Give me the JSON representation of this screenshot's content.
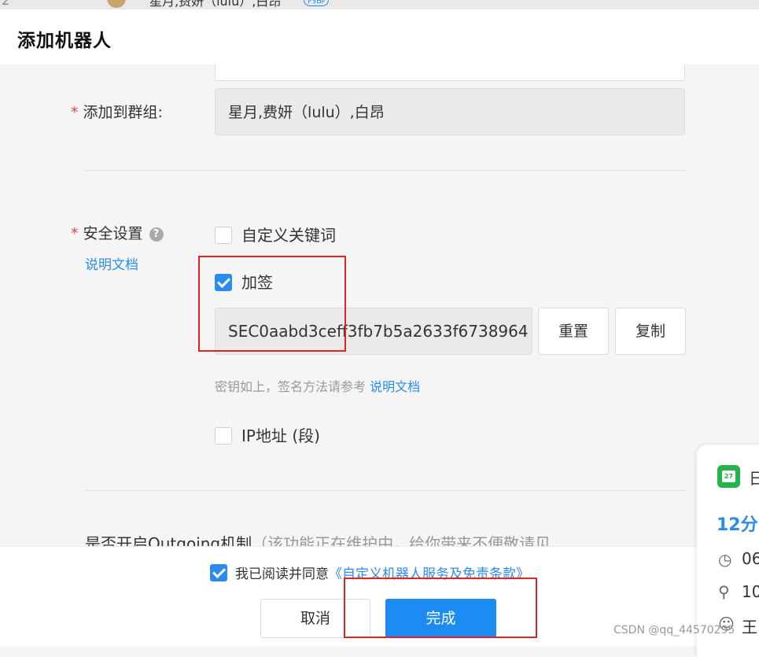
{
  "top_strip": {
    "count_text": "2",
    "chat_title": "星月,费妍（lulu）,白昂",
    "badge": "内部"
  },
  "dialog": {
    "title": "添加机器人"
  },
  "form": {
    "add_to_group_label": "添加到群组:",
    "group_value": "星月,费妍（lulu）,白昂",
    "security_label": "安全设置",
    "help_icon_glyph": "?",
    "doc_link": "说明文档",
    "options": {
      "custom_keywords": {
        "label": "自定义关键词",
        "checked": false
      },
      "signature": {
        "label": "加签",
        "checked": true
      },
      "ip_address": {
        "label": "IP地址 (段)",
        "checked": false
      }
    },
    "secret_value": "SEC0aabd3ceff3fb7b5a2633f6738964",
    "reset_button": "重置",
    "copy_button": "复制",
    "hint_text": "密钥如上，签名方法请参考",
    "hint_link": "说明文档",
    "outgoing_label": "是否开启Outgoing机制",
    "outgoing_note": "（该功能正在维护中，给你带来不便敬请见"
  },
  "footer": {
    "agree_checked": true,
    "agree_text": "我已阅读并同意",
    "agree_link": "《自定义机器人服务及免责条款》",
    "cancel_button": "取消",
    "done_button": "完成"
  },
  "side_panel": {
    "calendar_day": "27",
    "title_char": "日",
    "time_text": "12分",
    "row1": "06",
    "row2": "10",
    "row3": "王"
  },
  "watermark": "CSDN @qq_44570295",
  "colors": {
    "accent": "#2a8cf0",
    "primary_button": "#1c8bf3",
    "required_star": "#e04848",
    "highlight_box": "#e02424",
    "calendar_green": "#26b34a"
  },
  "icons": [
    "help-icon",
    "checkbox-icon",
    "calendar-icon",
    "clock-icon",
    "location-icon",
    "person-icon"
  ]
}
